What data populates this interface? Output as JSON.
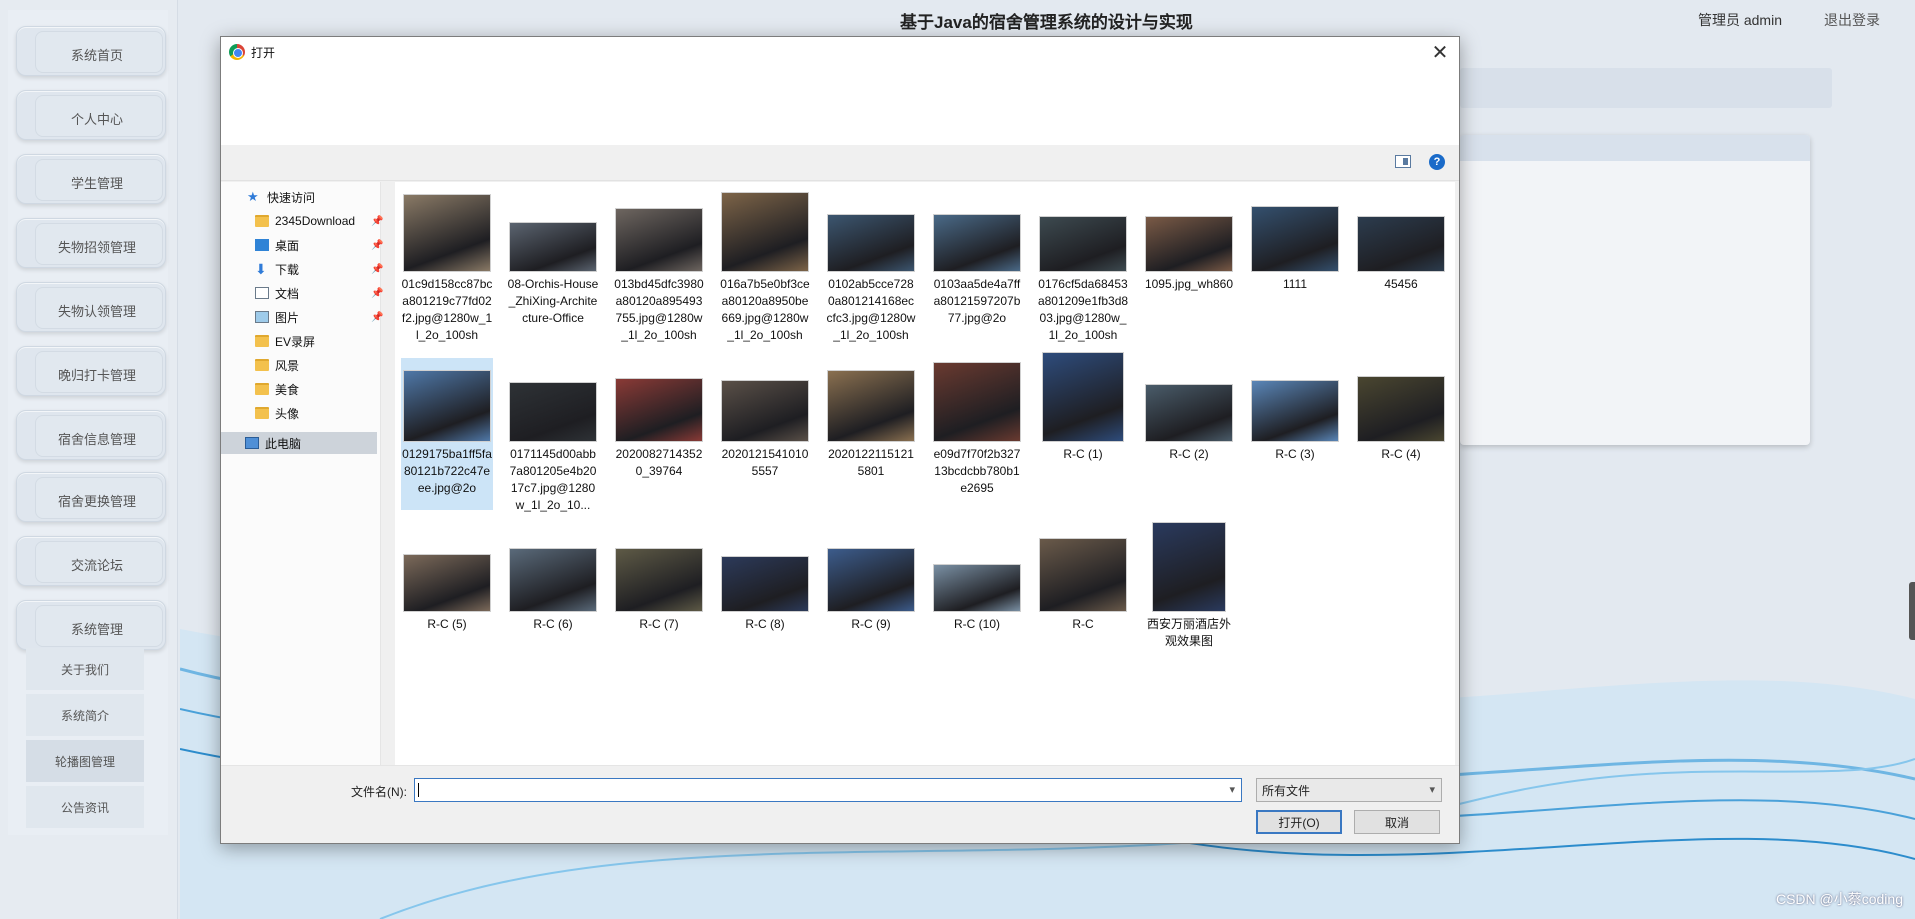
{
  "app": {
    "title": "基于Java的宿舍管理系统的设计与实现",
    "user": "管理员 admin",
    "logout": "退出登录",
    "watermark": "CSDN @小蔡coding",
    "nav": [
      "系统首页",
      "个人中心",
      "学生管理",
      "失物招领管理",
      "失物认领管理",
      "晚归打卡管理",
      "宿舍信息管理",
      "宿舍更换管理",
      "交流论坛",
      "系统管理"
    ],
    "sub_nav": [
      "关于我们",
      "系统简介",
      "轮播图管理",
      "公告资讯"
    ]
  },
  "dialog": {
    "title": "打开",
    "close_icon": "close-icon",
    "nav_tree": [
      {
        "label": "快速访问",
        "icon": "star-icon"
      },
      {
        "label": "2345Download",
        "icon": "folder-icon",
        "pinned": true
      },
      {
        "label": "桌面",
        "icon": "desktop-icon",
        "pinned": true
      },
      {
        "label": "下载",
        "icon": "download-icon",
        "pinned": true
      },
      {
        "label": "文档",
        "icon": "document-icon",
        "pinned": true
      },
      {
        "label": "图片",
        "icon": "pictures-icon",
        "pinned": true
      },
      {
        "label": "EV录屏",
        "icon": "folder-icon"
      },
      {
        "label": "风景",
        "icon": "folder-icon"
      },
      {
        "label": "美食",
        "icon": "folder-icon"
      },
      {
        "label": "头像",
        "icon": "folder-icon"
      },
      {
        "label": "此电脑",
        "icon": "computer-icon",
        "selected": true
      }
    ],
    "files": [
      {
        "name": "01c9d158cc87bca801219c77fd02f2.jpg@1280w_1l_2o_100sh",
        "color": "#8a7a66"
      },
      {
        "name": "08-Orchis-House_ZhiXing-Architecture-Office",
        "color": "#5b6470"
      },
      {
        "name": "013bd45dfc3980a80120a895493755.jpg@1280w_1l_2o_100sh",
        "color": "#6e6660"
      },
      {
        "name": "016a7b5e0bf3cea80120a8950be669.jpg@1280w_1l_2o_100sh",
        "color": "#7d6448"
      },
      {
        "name": "0102ab5cce7280a801214168eccfc3.jpg@1280w_1l_2o_100sh",
        "color": "#3c5670"
      },
      {
        "name": "0103aa5de4a7ffa80121597207b77.jpg@2o",
        "color": "#4a6a88"
      },
      {
        "name": "0176cf5da68453a801209e1fb3d803.jpg@1280w_1l_2o_100sh",
        "color": "#3d4a50"
      },
      {
        "name": "1095.jpg_wh860",
        "color": "#7a5a46"
      },
      {
        "name": "1111",
        "color": "#34506e"
      },
      {
        "name": "45456",
        "color": "#2c3c4e"
      },
      {
        "name": "0129175ba1ff5fa80121b722c47eee.jpg@2o",
        "color": "#4f78a8",
        "selected": true
      },
      {
        "name": "0171145d00abb7a801205e4b2017c7.jpg@1280w_1l_2o_10...",
        "color": "#2e3236"
      },
      {
        "name": "20200827143520_39764",
        "color": "#8a3a36"
      },
      {
        "name": "20201215410105557",
        "color": "#5a5048"
      },
      {
        "name": "20201221151215801",
        "color": "#8a7050"
      },
      {
        "name": "e09d7f70f2b32713bcdcbb780b1e2695",
        "color": "#6a3a30"
      },
      {
        "name": "R-C (1)",
        "color": "#2e4c7c"
      },
      {
        "name": "R-C (2)",
        "color": "#4a5c6a"
      },
      {
        "name": "R-C (3)",
        "color": "#5a86b8"
      },
      {
        "name": "R-C (4)",
        "color": "#4a4630"
      },
      {
        "name": "R-C (5)",
        "color": "#7c6a5a"
      },
      {
        "name": "R-C (6)",
        "color": "#5a6a7a"
      },
      {
        "name": "R-C (7)",
        "color": "#5e5a46"
      },
      {
        "name": "R-C (8)",
        "color": "#2c3a5a"
      },
      {
        "name": "R-C (9)",
        "color": "#3c5c8c"
      },
      {
        "name": "R-C (10)",
        "color": "#7a90a4"
      },
      {
        "name": "R-C",
        "color": "#6a5a4a"
      },
      {
        "name": "西安万丽酒店外观效果图",
        "color": "#2a3a5e"
      }
    ],
    "filename_label": "文件名(N):",
    "filename_value": "",
    "filetype": "所有文件",
    "open_label": "打开(O)",
    "cancel_label": "取消"
  }
}
